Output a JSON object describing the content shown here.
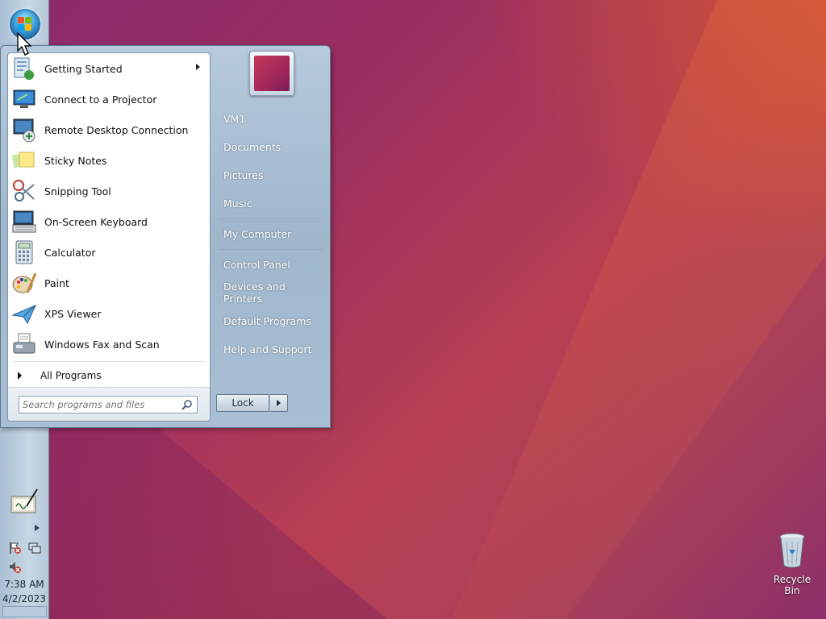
{
  "desktop": {
    "recycle_bin_label": "Recycle Bin"
  },
  "taskbar": {
    "clock_time": "7:38 AM",
    "clock_date": "4/2/2023"
  },
  "start_menu": {
    "programs": [
      {
        "label": "Getting Started",
        "icon": "getting-started-icon",
        "has_submenu": true
      },
      {
        "label": "Connect to a Projector",
        "icon": "projector-icon"
      },
      {
        "label": "Remote Desktop Connection",
        "icon": "remote-desktop-icon"
      },
      {
        "label": "Sticky Notes",
        "icon": "sticky-notes-icon"
      },
      {
        "label": "Snipping Tool",
        "icon": "scissors-icon"
      },
      {
        "label": "On-Screen Keyboard",
        "icon": "keyboard-icon"
      },
      {
        "label": "Calculator",
        "icon": "calculator-icon"
      },
      {
        "label": "Paint",
        "icon": "paint-palette-icon"
      },
      {
        "label": "XPS Viewer",
        "icon": "paper-plane-icon"
      },
      {
        "label": "Windows Fax and Scan",
        "icon": "fax-icon"
      }
    ],
    "all_programs_label": "All Programs",
    "search_placeholder": "Search programs and files",
    "right_items": {
      "user": "VM1",
      "documents": "Documents",
      "pictures": "Pictures",
      "music": "Music",
      "my_computer": "My Computer",
      "control_panel": "Control Panel",
      "devices_printers": "Devices and Printers",
      "default_programs": "Default Programs",
      "help_support": "Help and Support"
    },
    "lock_label": "Lock"
  }
}
